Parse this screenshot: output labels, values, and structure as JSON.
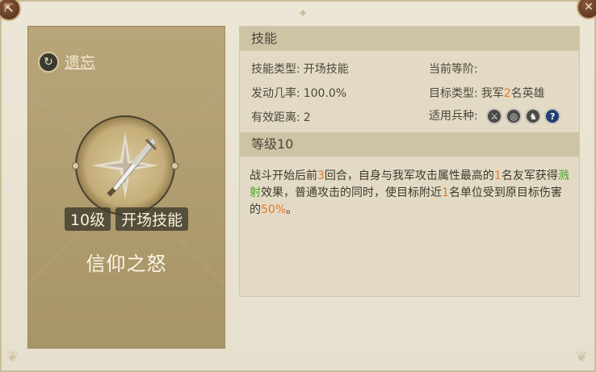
{
  "left": {
    "forget_label": "遗忘",
    "level_badge": "10级",
    "type_badge": "开场技能",
    "skill_name": "信仰之怒"
  },
  "skill_section": {
    "header": "技能",
    "type_label": "技能类型:",
    "type_value": "开场技能",
    "current_level_label": "当前等阶:",
    "current_level_value": "",
    "rate_label": "发动几率:",
    "rate_value": "100.0%",
    "target_label": "目标类型:",
    "target_prefix": "我军",
    "target_count": "2",
    "target_suffix": "名英雄",
    "range_label": "有效距离:",
    "range_value": "2",
    "unit_label": "适用兵种:",
    "unit_icons": [
      "sword-icon",
      "bow-target-icon",
      "horse-icon",
      "question-icon"
    ],
    "help_glyph": "?"
  },
  "level_section": {
    "header": "等级10",
    "desc_p1": "战斗开始后前",
    "desc_n1": "3",
    "desc_p2": "回合，自身与我军攻击属性最高的",
    "desc_n2": "1",
    "desc_p3": "名友军获得",
    "desc_effect": "溅射",
    "desc_p4": "效果，普通攻击的同时，使目标附近",
    "desc_n3": "1",
    "desc_p5": "名单位受到原目标伤害的",
    "desc_pct": "50%",
    "desc_p6": "。"
  },
  "colors": {
    "highlight_number": "#e0782a",
    "highlight_effect": "#4ea428"
  }
}
